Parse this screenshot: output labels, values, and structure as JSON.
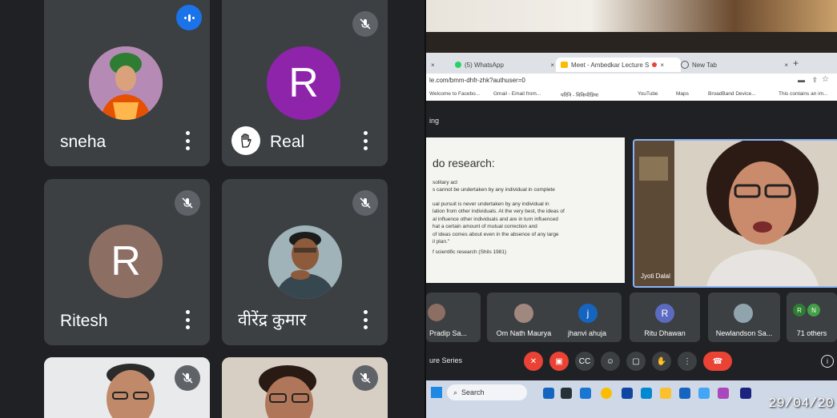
{
  "left_panel": {
    "participants": [
      {
        "name": "sneha",
        "type": "photo",
        "indicator": "speaking"
      },
      {
        "name": "Real",
        "type": "letter",
        "letter": "R",
        "avatar_color": "#8e24aa",
        "indicator": "mic-off",
        "hand_raised": true
      },
      {
        "name": "Ritesh",
        "type": "letter",
        "letter": "R",
        "avatar_color": "#8d6e63",
        "indicator": "mic-off"
      },
      {
        "name": "वीरेंद्र कुमार",
        "type": "photo",
        "indicator": "mic-off"
      },
      {
        "name": "",
        "type": "video",
        "indicator": "mic-off"
      },
      {
        "name": "",
        "type": "video",
        "indicator": "mic-off"
      }
    ]
  },
  "right_panel": {
    "browser": {
      "tabs": [
        {
          "label": "(5) WhatsApp"
        },
        {
          "label": "Meet - Ambedkar Lecture S"
        },
        {
          "label": "New Tab"
        }
      ],
      "url": "le.com/bmm-dhfr-zhk?authuser=0",
      "bookmarks": [
        "Welcome to Facebo...",
        "Gmail - Email from...",
        "परिनि - विकिपीडिया",
        "YouTube",
        "Maps",
        "BroadBand Device...",
        "This contains an im..."
      ]
    },
    "meeting_label": "ing",
    "slide": {
      "heading": "do research:",
      "lines": [
        "solitary act",
        "s cannot be undertaken by any individual in complete",
        "ual pursuit is never undertaken by any individual in",
        "lation from other individuals. At the very best, the ideas of",
        "al influence other individuals and are in turn influenced",
        "hat a certain amount of mutual correction and",
        "of ideas comes about even in the absence of any large",
        "il plan.\"",
        "f scientific research (Shils 1981)"
      ]
    },
    "presenter": {
      "name": "Jyoti Dalal"
    },
    "thumbnails": [
      {
        "name": "Pradip Sa..."
      },
      {
        "name": "Om Nath Maurya"
      },
      {
        "name": "jhanvi ahuja",
        "letter": "j",
        "color": "#1565c0"
      },
      {
        "name": "Ritu Dhawan",
        "letter": "R",
        "color": "#5c6bc0"
      },
      {
        "name": "Newlandson Sa..."
      },
      {
        "name": "71 others",
        "letters": [
          "R",
          "N"
        ]
      }
    ],
    "meeting_title": "ure Series",
    "taskbar": {
      "search_label": "Search"
    },
    "date_stamp": "29/04/20"
  }
}
